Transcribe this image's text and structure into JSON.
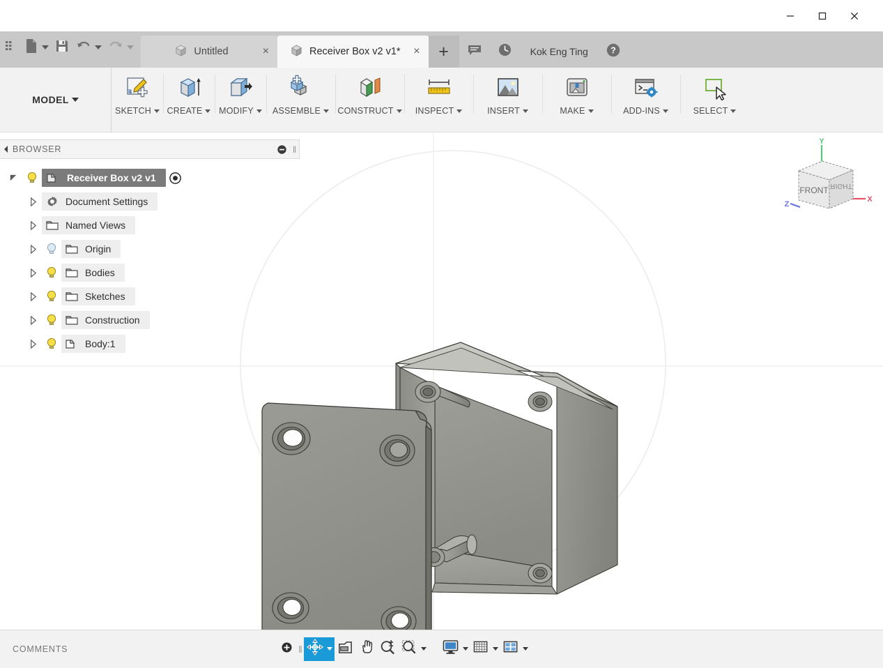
{
  "window": {
    "controls": [
      {
        "name": "minimize-button",
        "glyph": "minimize"
      },
      {
        "name": "maximize-button",
        "glyph": "maximize"
      },
      {
        "name": "close-button",
        "glyph": "close"
      }
    ]
  },
  "quick_access": {
    "items": [
      {
        "name": "app-grid-button",
        "icon": "grid-icon",
        "has_caret": false
      },
      {
        "name": "new-document-button",
        "icon": "document-icon",
        "has_caret": true
      },
      {
        "name": "save-button",
        "icon": "save-icon",
        "has_caret": false
      },
      {
        "name": "undo-button",
        "icon": "undo-icon",
        "has_caret": true
      },
      {
        "name": "redo-button",
        "icon": "redo-icon",
        "has_caret": true,
        "disabled": true
      }
    ]
  },
  "tabs": [
    {
      "label": "Untitled",
      "active": false,
      "close": "×"
    },
    {
      "label": "Receiver Box v2 v1*",
      "active": true,
      "close": "×"
    }
  ],
  "tab_actions": {
    "new_tab_label": "+",
    "comment_icon": "comment-icon",
    "history_icon": "clock-icon",
    "help_icon": "help-icon",
    "user_name": "Kok Eng Ting"
  },
  "ribbon": {
    "workspace": "MODEL",
    "groups": [
      {
        "label": "SKETCH",
        "icon": "sketch-icon",
        "caret": true
      },
      {
        "label": "CREATE",
        "icon": "create-extrude-icon",
        "caret": true
      },
      {
        "label": "MODIFY",
        "icon": "modify-press-pull-icon",
        "caret": true
      },
      {
        "label": "ASSEMBLE",
        "icon": "assemble-icon",
        "caret": true
      },
      {
        "label": "CONSTRUCT",
        "icon": "construct-plane-icon",
        "caret": true
      },
      {
        "label": "INSPECT",
        "icon": "inspect-measure-icon",
        "caret": true
      },
      {
        "label": "INSERT",
        "icon": "insert-image-icon",
        "caret": true
      },
      {
        "label": "MAKE",
        "icon": "make-3d-print-icon",
        "caret": true
      },
      {
        "label": "ADD-INS",
        "icon": "add-ins-script-icon",
        "caret": true
      },
      {
        "label": "SELECT",
        "icon": "select-cursor-icon",
        "caret": true
      }
    ]
  },
  "browser": {
    "title": "BROWSER",
    "collapse_icon": "collapse-arrow-icon",
    "minus_icon": "minus-circle-icon",
    "grip_icon": "resize-grip-icon",
    "tree": [
      {
        "label": "Receiver Box v2 v1",
        "level": 0,
        "root": true,
        "arrow": "triangle-down",
        "bulb": "on",
        "icon": "component-icon",
        "radio": "radio-selected-icon"
      },
      {
        "label": "Document Settings",
        "level": 1,
        "arrow": "triangle-right",
        "bulb": "none",
        "icon": "gear-icon"
      },
      {
        "label": "Named Views",
        "level": 1,
        "arrow": "triangle-right",
        "bulb": "none",
        "icon": "folder-icon"
      },
      {
        "label": "Origin",
        "level": 1,
        "arrow": "triangle-right",
        "bulb": "off",
        "icon": "folder-icon"
      },
      {
        "label": "Bodies",
        "level": 1,
        "arrow": "triangle-right",
        "bulb": "on",
        "icon": "folder-icon"
      },
      {
        "label": "Sketches",
        "level": 1,
        "arrow": "triangle-right",
        "bulb": "on",
        "icon": "folder-icon"
      },
      {
        "label": "Construction",
        "level": 1,
        "arrow": "triangle-right",
        "bulb": "on",
        "icon": "folder-icon"
      },
      {
        "label": "Body:1",
        "level": 1,
        "arrow": "triangle-right",
        "bulb": "on",
        "icon": "body-icon"
      }
    ]
  },
  "viewcube": {
    "front_face": "FRONT",
    "right_face": "RIGHT",
    "axes": [
      {
        "label": "X",
        "color": "#e8546b"
      },
      {
        "label": "Y",
        "color": "#57c878"
      },
      {
        "label": "Z",
        "color": "#6a74e0"
      }
    ]
  },
  "status_bar": {
    "comments_label": "COMMENTS",
    "nav_items": [
      {
        "name": "add-marker-button",
        "icon": "plus-circle-icon",
        "caret": false,
        "active": false
      },
      {
        "name": "orbit-button",
        "icon": "orbit-icon",
        "caret": true,
        "active": true
      },
      {
        "name": "look-at-button",
        "icon": "look-at-icon",
        "caret": false,
        "active": false
      },
      {
        "name": "pan-button",
        "icon": "pan-hand-icon",
        "caret": false,
        "active": false
      },
      {
        "name": "zoom-button",
        "icon": "zoom-icon",
        "caret": false,
        "active": false
      },
      {
        "name": "fit-button",
        "icon": "zoom-fit-icon",
        "caret": true,
        "active": false
      },
      {
        "name": "display-settings-button",
        "icon": "display-monitor-icon",
        "caret": true,
        "active": false
      },
      {
        "name": "grid-snaps-button",
        "icon": "grid-snap-icon",
        "caret": true,
        "active": false
      },
      {
        "name": "viewports-button",
        "icon": "viewports-icon",
        "caret": true,
        "active": false
      }
    ]
  },
  "colors": {
    "accent": "#1a9ad7",
    "model_fill": "#8e8e88",
    "model_light": "#b9b9b3",
    "model_dark": "#6f6f6a",
    "tab_active": "#f7f7f7",
    "tab_inactive": "#d4d4d4",
    "ribbon_bg": "#f2f2f2",
    "tabbar_bg": "#c8c8c8"
  },
  "model": {
    "description": "Receiver Box v2 — enclosure shell with removable lid plate, four corner screw bosses"
  }
}
